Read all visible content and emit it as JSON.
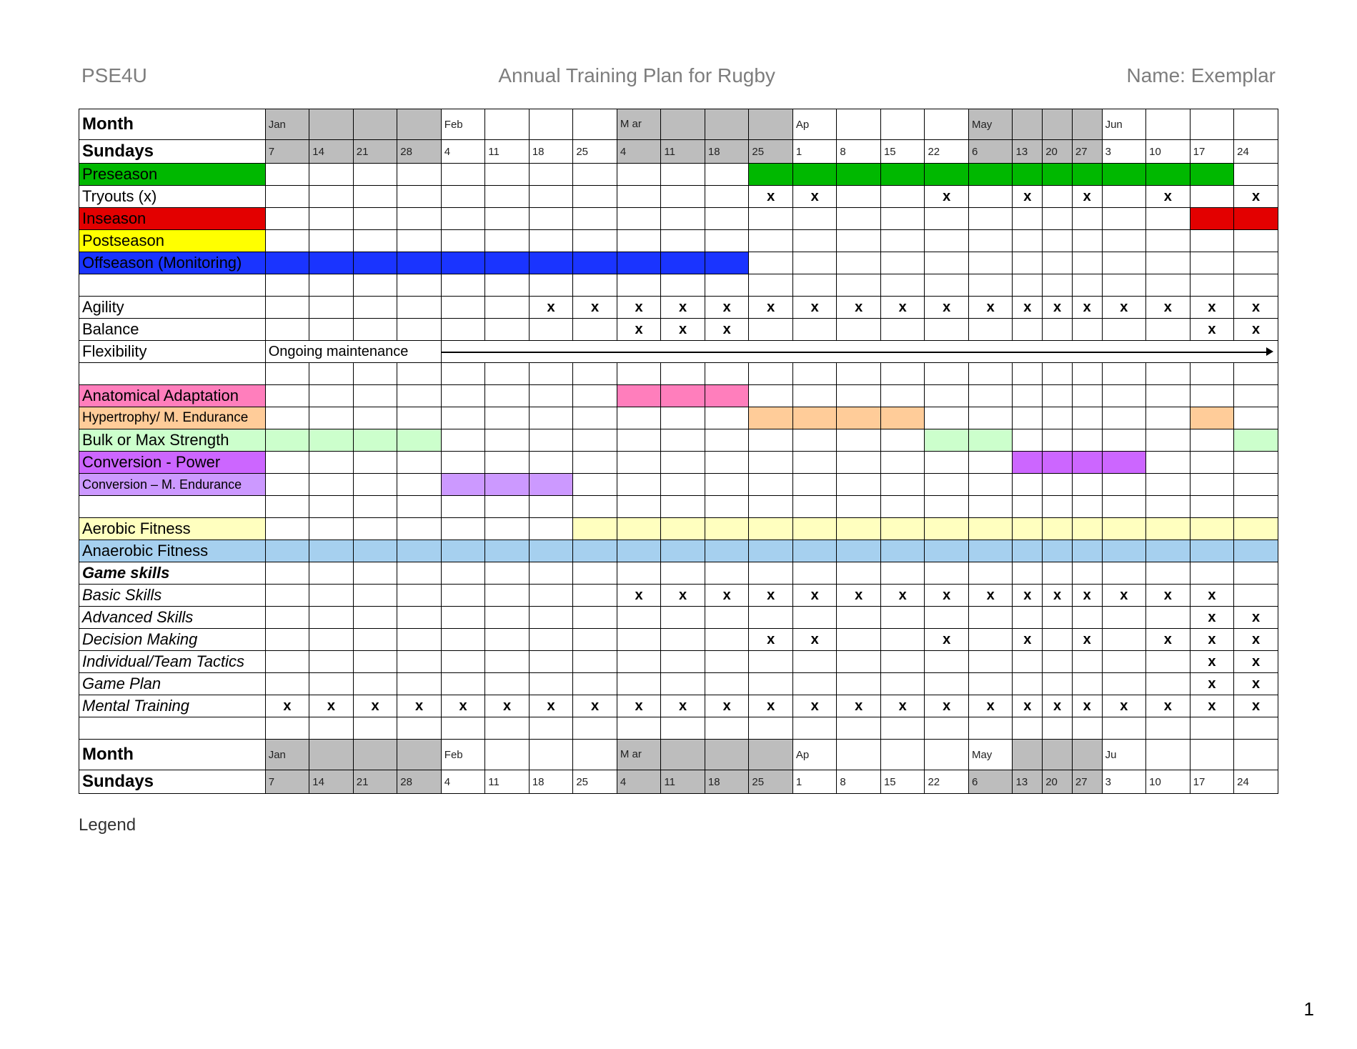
{
  "header": {
    "code": "PSE4U",
    "title": "Annual Training Plan for Rugby",
    "name": "Name: Exemplar"
  },
  "legend": "Legend",
  "page_num": "1",
  "colors": {
    "grey": "#bdbdbd",
    "green": "#00b800",
    "red": "#e30000",
    "yellow": "#ffff00",
    "blue": "#1a34ff",
    "pink": "#ff7ebc",
    "peach": "#ffcc99",
    "mint": "#ccffcc",
    "violet": "#cc66ff",
    "lav": "#cc99ff",
    "paleyellow": "#ffffbf",
    "paleblue": "#a6d0ef"
  },
  "months": {
    "label": "Month",
    "cells": [
      {
        "t": "Jan",
        "bg": "grey",
        "cs": 1
      },
      {
        "t": "",
        "bg": "grey",
        "cs": 1
      },
      {
        "t": "",
        "bg": "grey",
        "cs": 1
      },
      {
        "t": "",
        "bg": "grey",
        "cs": 1
      },
      {
        "t": "Feb",
        "cs": 1
      },
      {
        "t": "",
        "cs": 1
      },
      {
        "t": "",
        "cs": 1
      },
      {
        "t": "",
        "cs": 1
      },
      {
        "t": "M ar",
        "bg": "grey",
        "cs": 1,
        "wrap": 1
      },
      {
        "t": "",
        "bg": "grey",
        "cs": 1
      },
      {
        "t": "",
        "bg": "grey",
        "cs": 1
      },
      {
        "t": "",
        "bg": "grey",
        "cs": 1
      },
      {
        "t": "Ap",
        "cs": 1
      },
      {
        "t": "",
        "cs": 1
      },
      {
        "t": "",
        "cs": 1
      },
      {
        "t": "",
        "cs": 1
      },
      {
        "t": "May",
        "bg": "grey",
        "cs": 1
      },
      {
        "t": "",
        "bg": "grey",
        "cs": 1
      },
      {
        "t": "",
        "bg": "grey",
        "cs": 1
      },
      {
        "t": "",
        "bg": "grey",
        "cs": 1
      },
      {
        "t": "Jun",
        "cs": 1
      },
      {
        "t": "",
        "cs": 1
      },
      {
        "t": "",
        "cs": 1
      },
      {
        "t": "",
        "cs": 1
      }
    ]
  },
  "sundays": {
    "label": "Sundays",
    "vals": [
      "7",
      "14",
      "21",
      "28",
      "4",
      "11",
      "18",
      "25",
      "4",
      "11",
      "18",
      "25",
      "1",
      "8",
      "15",
      "22",
      "6",
      "13",
      "20",
      "27",
      "3",
      "10",
      "17",
      "24"
    ],
    "greys": [
      1,
      1,
      1,
      1,
      0,
      0,
      0,
      0,
      1,
      1,
      1,
      1,
      0,
      0,
      0,
      0,
      1,
      1,
      1,
      1,
      0,
      0,
      0,
      0
    ]
  },
  "months2": {
    "label": "Month",
    "cells": [
      {
        "t": "Jan",
        "bg": "grey",
        "cs": 1
      },
      {
        "t": "",
        "bg": "grey",
        "cs": 1
      },
      {
        "t": "",
        "bg": "grey",
        "cs": 1
      },
      {
        "t": "",
        "bg": "grey",
        "cs": 1
      },
      {
        "t": "Feb",
        "cs": 1
      },
      {
        "t": "",
        "cs": 1
      },
      {
        "t": "",
        "cs": 1
      },
      {
        "t": "",
        "cs": 1
      },
      {
        "t": "M ar",
        "bg": "grey",
        "cs": 1,
        "wrap": 1
      },
      {
        "t": "",
        "bg": "grey",
        "cs": 1
      },
      {
        "t": "",
        "bg": "grey",
        "cs": 1
      },
      {
        "t": "",
        "bg": "grey",
        "cs": 1
      },
      {
        "t": "Ap",
        "cs": 1
      },
      {
        "t": "",
        "cs": 1
      },
      {
        "t": "",
        "cs": 1
      },
      {
        "t": "",
        "cs": 1
      },
      {
        "t": "May",
        "cs": 1
      },
      {
        "t": "",
        "bg": "grey",
        "cs": 1
      },
      {
        "t": "",
        "bg": "grey",
        "cs": 1
      },
      {
        "t": "",
        "bg": "grey",
        "cs": 1
      },
      {
        "t": "Ju",
        "cs": 1
      },
      {
        "t": "",
        "cs": 1
      },
      {
        "t": "",
        "cs": 1
      },
      {
        "t": "",
        "cs": 1
      }
    ]
  },
  "rows": [
    {
      "label": "Preseason",
      "lbg": "green",
      "cells": {
        "fill": [
          [
            11,
            22,
            "green"
          ]
        ]
      }
    },
    {
      "label": "Tryouts (x)",
      "x": [
        11,
        12,
        15,
        17,
        19,
        21,
        23
      ],
      "xbold": [
        11,
        12,
        15,
        17,
        19,
        21
      ],
      "xreg": [
        23
      ]
    },
    {
      "label": "Inseason",
      "lbg": "red",
      "cells": {
        "fill": [
          [
            22,
            23,
            "red"
          ]
        ]
      }
    },
    {
      "label": "Postseason",
      "lbg": "yellow"
    },
    {
      "label": "Offseason (Monitoring)",
      "lbg": "blue",
      "cells": {
        "fill": [
          [
            0,
            10,
            "blue"
          ]
        ]
      }
    },
    {
      "blank": 1
    },
    {
      "label": "Agility",
      "x": [
        6,
        7,
        8,
        9,
        10,
        11,
        12,
        13,
        14,
        15,
        16,
        17,
        18,
        19,
        20,
        21,
        22,
        23
      ]
    },
    {
      "label": "Balance",
      "x": [
        8,
        9,
        10,
        22,
        23
      ]
    },
    {
      "label": "Flexibility",
      "special": "flex"
    },
    {
      "blank": 1
    },
    {
      "label": "Anatomical Adaptation",
      "lbg": "pink",
      "cells": {
        "fill": [
          [
            8,
            10,
            "pink"
          ]
        ]
      }
    },
    {
      "label": "Hypertrophy/ M. Endurance",
      "lbg": "peach",
      "lsize": "19px",
      "cells": {
        "fill": [
          [
            11,
            14,
            "peach"
          ],
          [
            22,
            22,
            "peach"
          ]
        ]
      }
    },
    {
      "label": "Bulk or Max Strength",
      "lbg": "mint",
      "cells": {
        "fill": [
          [
            0,
            3,
            "mint"
          ],
          [
            15,
            16,
            "mint"
          ],
          [
            23,
            23,
            "mint"
          ]
        ]
      }
    },
    {
      "label": "Conversion - Power",
      "lbg": "violet",
      "cells": {
        "fill": [
          [
            17,
            20,
            "violet"
          ]
        ]
      }
    },
    {
      "label": "Conversion – M. Endurance",
      "lbg": "lav",
      "lsize": "18px",
      "cells": {
        "fill": [
          [
            4,
            6,
            "lav"
          ]
        ]
      }
    },
    {
      "blank": 1
    },
    {
      "label": "Aerobic Fitness",
      "lbg": "paleyellow",
      "cells": {
        "fill": [
          [
            7,
            23,
            "paleyellow"
          ]
        ]
      }
    },
    {
      "label": "Anaerobic Fitness",
      "lbg": "paleblue",
      "cells": {
        "fill": [
          [
            0,
            23,
            "paleblue"
          ]
        ]
      }
    },
    {
      "label": "Game skills",
      "cls": "itb"
    },
    {
      "label": "Basic Skills",
      "cls": "it",
      "x": [
        8,
        9,
        10,
        11,
        12,
        13,
        14,
        15,
        16,
        17,
        18,
        19,
        20,
        21,
        22
      ]
    },
    {
      "label": "Advanced Skills",
      "cls": "it",
      "x": [
        22,
        23
      ]
    },
    {
      "label": "Decision Making",
      "cls": "it",
      "x": [
        11,
        12,
        15,
        17,
        19,
        21,
        22,
        23
      ]
    },
    {
      "label": "Individual/Team Tactics",
      "cls": "it",
      "wrap": 1,
      "x": [
        22,
        23
      ]
    },
    {
      "label": "Game Plan",
      "cls": "it",
      "x": [
        22,
        23
      ]
    },
    {
      "label": "Mental Training",
      "cls": "it",
      "x": [
        0,
        1,
        2,
        3,
        4,
        5,
        6,
        7,
        8,
        9,
        10,
        11,
        12,
        13,
        14,
        15,
        16,
        17,
        18,
        19,
        20,
        21,
        22,
        23
      ]
    },
    {
      "blank": 1
    }
  ],
  "flex_text": "Ongoing maintenance"
}
